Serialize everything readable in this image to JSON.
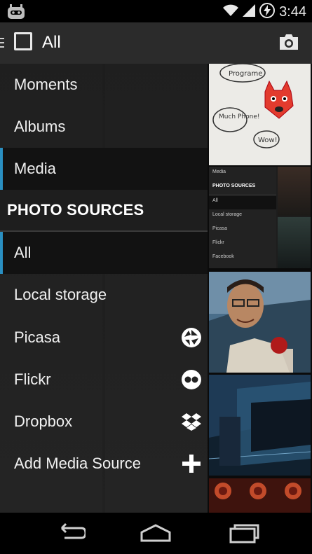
{
  "status_bar": {
    "time": "3:44",
    "icons": [
      "cyanogenmod-icon",
      "wifi-icon",
      "signal-icon",
      "battery-charging-icon"
    ]
  },
  "action_bar": {
    "title": "All",
    "icons": [
      "drawer-indicator-icon",
      "checkbox-icon",
      "camera-icon"
    ]
  },
  "drawer": {
    "items": [
      {
        "label": "Moments"
      },
      {
        "label": "Albums"
      },
      {
        "label": "Media",
        "selected": true
      }
    ],
    "section_header": "PHOTO SOURCES",
    "sources": [
      {
        "label": "All",
        "selected": true
      },
      {
        "label": "Local storage"
      },
      {
        "label": "Picasa",
        "icon": "picasa-icon"
      },
      {
        "label": "Flickr",
        "icon": "flickr-icon"
      },
      {
        "label": "Dropbox",
        "icon": "dropbox-icon"
      },
      {
        "label": "Add Media Source",
        "icon": "plus-icon"
      }
    ]
  },
  "thumbnails": {
    "preview": {
      "items": [
        "Media",
        "PHOTO SOURCES",
        "All",
        "Local storage",
        "Picasa",
        "Flickr",
        "Facebook"
      ]
    },
    "whiteboard": {
      "labels": [
        "Programe",
        "Much Phone!",
        "Wow!"
      ]
    }
  },
  "nav_bar": {
    "icons": [
      "back-icon",
      "home-icon",
      "recents-icon"
    ]
  },
  "colors": {
    "accent": "#2a8fc1",
    "drawer_bg": "#202020",
    "action_bar_bg": "#2b2b2b"
  }
}
